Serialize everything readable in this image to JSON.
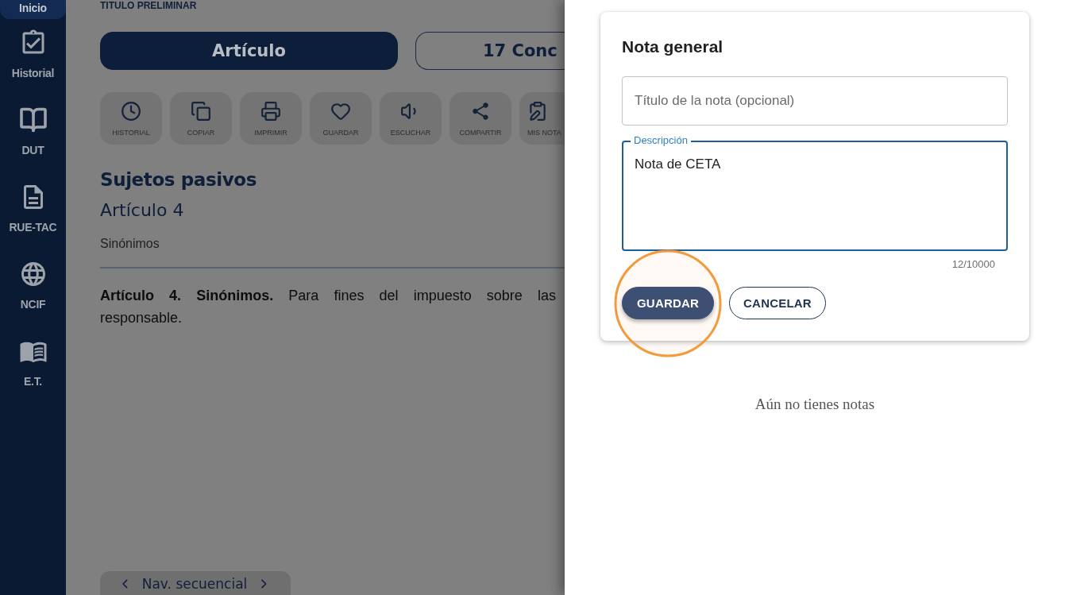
{
  "sidebar": {
    "items": [
      {
        "label": "Inicio",
        "selected": true
      },
      {
        "label": "Historial",
        "selected": false
      },
      {
        "label": "DUT",
        "selected": false
      },
      {
        "label": "RUE-TAC",
        "selected": false
      },
      {
        "label": "NCIF",
        "selected": false
      },
      {
        "label": "E.T.",
        "selected": false
      }
    ]
  },
  "article": {
    "breadcrumb": "TITULO PRELIMINAR",
    "view_tabs": [
      {
        "label": "Artículo",
        "selected": true
      },
      {
        "label": "17 Conc",
        "selected": false
      }
    ],
    "actions": [
      "HISTORIAL",
      "COPIAR",
      "IMPRIMIR",
      "GUARDAR",
      "ESCUCHAR",
      "COMPARTIR",
      "MIS NOTA"
    ],
    "heading": "Sujetos pasivos",
    "number": "Artículo 4",
    "subtitle": "Sinónimos",
    "text_lines": [
      "**Artículo 4. Sinónimos.** Para fines del impuesto sobre las",
      "responsable."
    ],
    "sequential_nav": {
      "label": "Nav. secuencial"
    }
  },
  "note_panel": {
    "title": "Nota general",
    "title_field": {
      "placeholder": "Título de la nota (opcional)",
      "focused": false
    },
    "description_field": {
      "label": "Descripción",
      "value": "Nota de CETA",
      "counter": "12/10000",
      "focused": true
    },
    "buttons": [
      {
        "label": "GUARDAR",
        "kind": "primary",
        "highlighted": true
      },
      {
        "label": "CANCELAR",
        "kind": "outlined",
        "highlighted": false
      }
    ],
    "empty_message": "Aún no tienes notas"
  }
}
